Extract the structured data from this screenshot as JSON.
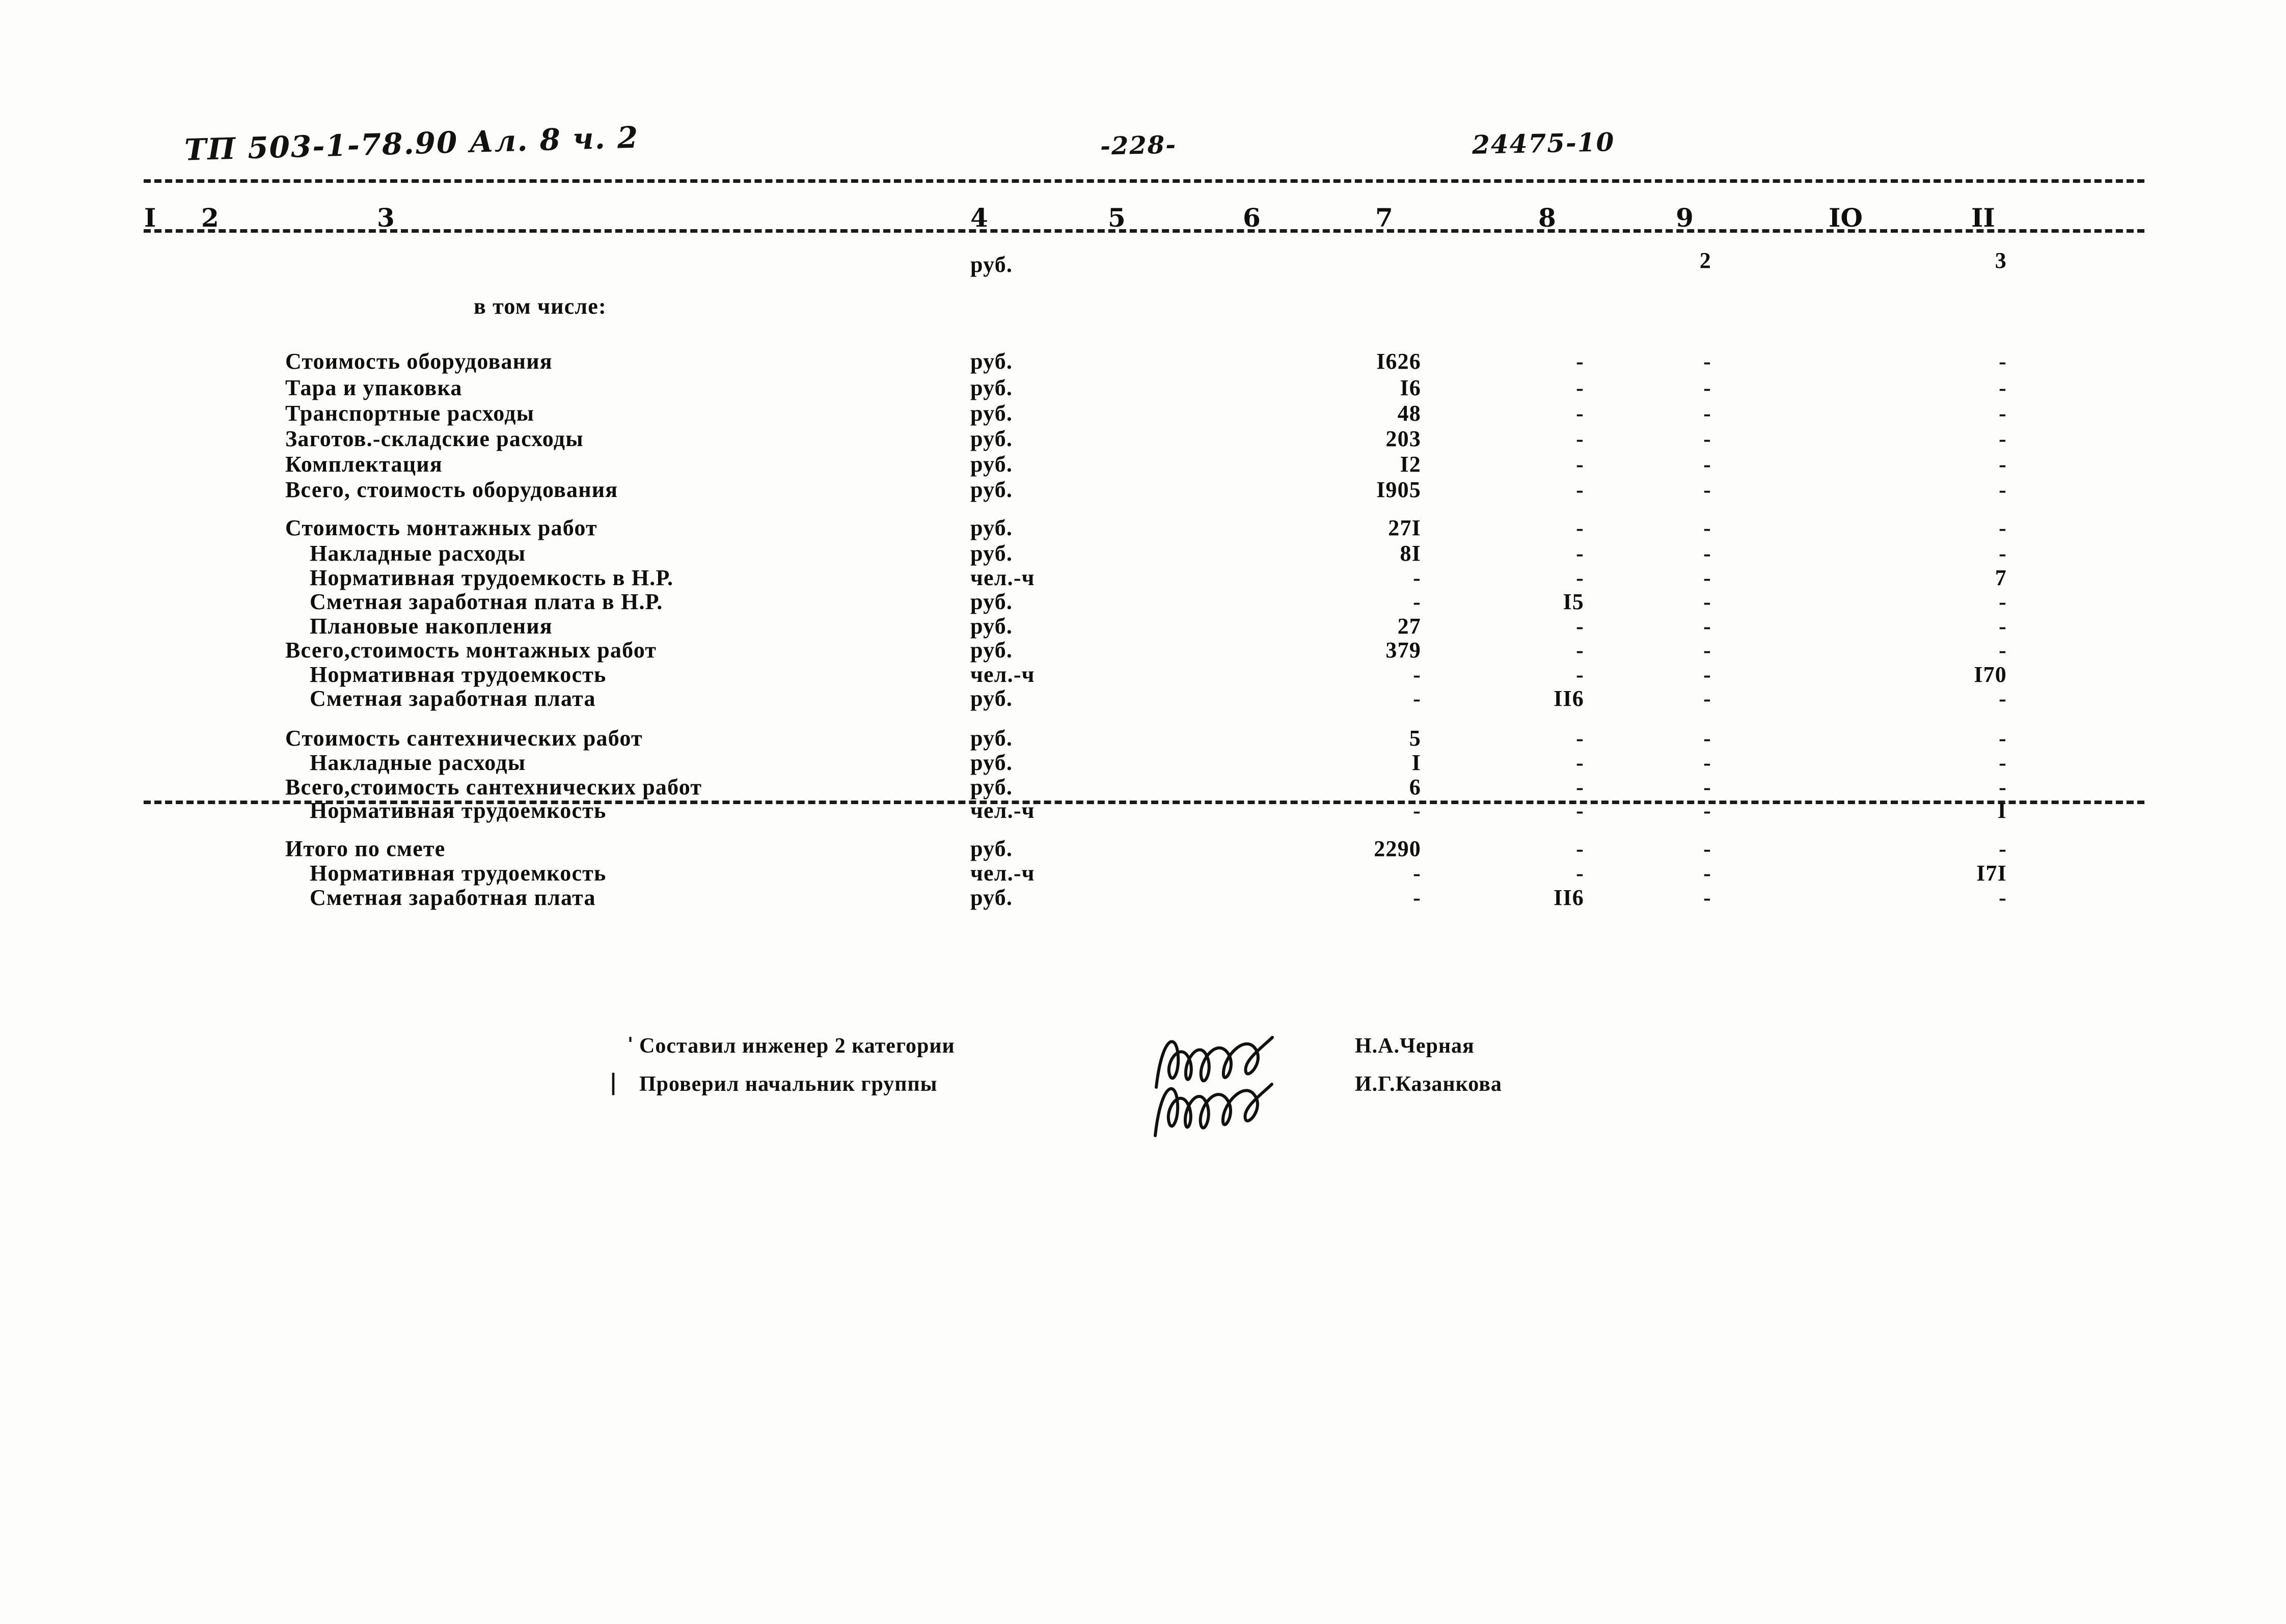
{
  "header": {
    "handwritten_code": "ТП 503-1-78.90 Ал. 8 ч. 2",
    "page_number": "-228-",
    "document_number": "24475-10"
  },
  "table": {
    "column_numbers": [
      "I",
      "2",
      "3",
      "4",
      "5",
      "6",
      "7",
      "8",
      "9",
      "IO",
      "II"
    ],
    "header_row": {
      "unit": "руб.",
      "col7": "",
      "col8": "",
      "col9": "2",
      "col11": "3"
    },
    "section_caption": "в том числе:",
    "rows": [
      {
        "label": "Стоимость оборудования",
        "indent": 0,
        "unit": "руб.",
        "col7": "I626",
        "col8": "-",
        "col9": "-",
        "col11": "-"
      },
      {
        "label": "Тара и упаковка",
        "indent": 0,
        "unit": "руб.",
        "col7": "I6",
        "col8": "-",
        "col9": "-",
        "col11": "-"
      },
      {
        "label": "Транспортные расходы",
        "indent": 0,
        "unit": "руб.",
        "col7": "48",
        "col8": "-",
        "col9": "-",
        "col11": "-"
      },
      {
        "label": "Заготов.-складские расходы",
        "indent": 0,
        "unit": "руб.",
        "col7": "203",
        "col8": "-",
        "col9": "-",
        "col11": "-"
      },
      {
        "label": "Комплектация",
        "indent": 0,
        "unit": "руб.",
        "col7": "I2",
        "col8": "-",
        "col9": "-",
        "col11": "-"
      },
      {
        "label": "Всего, стоимость оборудования",
        "indent": 0,
        "unit": "руб.",
        "col7": "I905",
        "col8": "-",
        "col9": "-",
        "col11": "-"
      },
      {
        "label": "Стоимость монтажных работ",
        "indent": 0,
        "unit": "руб.",
        "col7": "27I",
        "col8": "-",
        "col9": "-",
        "col11": "-"
      },
      {
        "label": "Накладные расходы",
        "indent": 1,
        "unit": "руб.",
        "col7": "8I",
        "col8": "-",
        "col9": "-",
        "col11": "-"
      },
      {
        "label": "Нормативная трудоемкость в Н.Р.",
        "indent": 1,
        "unit": "чел.-ч",
        "col7": "-",
        "col8": "-",
        "col9": "-",
        "col11": "7"
      },
      {
        "label": "Сметная заработная плата в Н.Р.",
        "indent": 1,
        "unit": "руб.",
        "col7": "-",
        "col8": "I5",
        "col9": "-",
        "col11": "-"
      },
      {
        "label": "Плановые накопления",
        "indent": 1,
        "unit": "руб.",
        "col7": "27",
        "col8": "-",
        "col9": "-",
        "col11": "-"
      },
      {
        "label": "Всего,стоимость монтажных работ",
        "indent": 0,
        "unit": "руб.",
        "col7": "379",
        "col8": "-",
        "col9": "-",
        "col11": "-"
      },
      {
        "label": "Нормативная трудоемкость",
        "indent": 1,
        "unit": "чел.-ч",
        "col7": "-",
        "col8": "-",
        "col9": "-",
        "col11": "I70"
      },
      {
        "label": "Сметная заработная плата",
        "indent": 1,
        "unit": "руб.",
        "col7": "-",
        "col8": "II6",
        "col9": "-",
        "col11": "-"
      },
      {
        "label": "Стоимость сантехнических работ",
        "indent": 0,
        "unit": "руб.",
        "col7": "5",
        "col8": "-",
        "col9": "-",
        "col11": "-"
      },
      {
        "label": "Накладные расходы",
        "indent": 1,
        "unit": "руб.",
        "col7": "I",
        "col8": "-",
        "col9": "-",
        "col11": "-"
      },
      {
        "label": "Всего,стоимость сантехнических работ",
        "indent": 0,
        "unit": "руб.",
        "col7": "6",
        "col8": "-",
        "col9": "-",
        "col11": "-"
      },
      {
        "label": "Нормативная трудоемкость",
        "indent": 1,
        "unit": "чел.-ч",
        "col7": "-",
        "col8": "-",
        "col9": "-",
        "col11": "I"
      },
      {
        "label": "Итого по смете",
        "indent": 0,
        "unit": "руб.",
        "col7": "2290",
        "col8": "-",
        "col9": "-",
        "col11": "-"
      },
      {
        "label": "Нормативная трудоемкость",
        "indent": 1,
        "unit": "чел.-ч",
        "col7": "-",
        "col8": "-",
        "col9": "-",
        "col11": "I7I"
      },
      {
        "label": "Сметная заработная плата",
        "indent": 1,
        "unit": "руб.",
        "col7": "-",
        "col8": "II6",
        "col9": "-",
        "col11": "-"
      }
    ]
  },
  "signatures": [
    {
      "role": "Составил инженер 2 категории",
      "name": "Н.А.Черная"
    },
    {
      "role": "Проверил начальник группы",
      "name": "И.Г.Казанкова"
    }
  ]
}
